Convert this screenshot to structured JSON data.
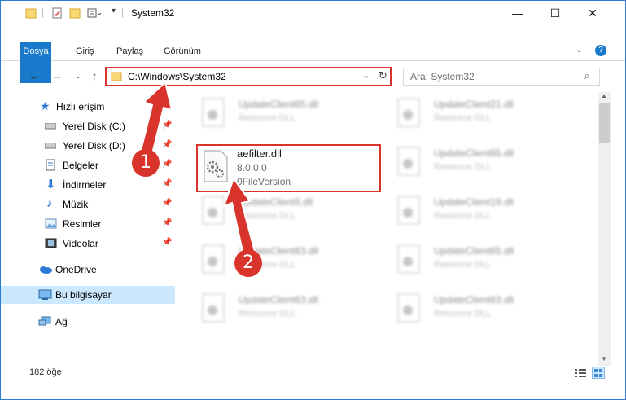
{
  "window": {
    "title": "System32"
  },
  "ribbon": {
    "tabs": [
      "Dosya",
      "Giriş",
      "Paylaş",
      "Görünüm"
    ]
  },
  "address": {
    "path": "C:\\Windows\\System32"
  },
  "search": {
    "placeholder": "Ara: System32"
  },
  "sidebar": {
    "items": [
      {
        "label": "Hızlı erişim"
      },
      {
        "label": "Yerel Disk (C:)"
      },
      {
        "label": "Yerel Disk (D:)"
      },
      {
        "label": "Belgeler"
      },
      {
        "label": "İndirmeler"
      },
      {
        "label": "Müzik"
      },
      {
        "label": "Resimler"
      },
      {
        "label": "Videolar"
      },
      {
        "label": "OneDrive"
      },
      {
        "label": "Bu bilgisayar"
      },
      {
        "label": "Ağ"
      }
    ]
  },
  "highlight_file": {
    "name": "aefilter.dll",
    "version": "8.0.0.0",
    "file_version": "0FileVersion"
  },
  "files": [
    {
      "name": "UpdateClient65.dll",
      "desc": "Resource DLL"
    },
    {
      "name": "UpdateClient21.dll",
      "desc": "Resource DLL"
    },
    {
      "name": "UpdateClient65.dll",
      "desc": "Resource DLL"
    },
    {
      "name": "UpdateClient5.dll",
      "desc": "Resource DLL"
    },
    {
      "name": "UpdateClient19.dll",
      "desc": "Resource DLL"
    },
    {
      "name": "UpdateClient63.dll",
      "desc": "Resource DLL"
    },
    {
      "name": "UpdateClient65.dll",
      "desc": "Resource DLL"
    },
    {
      "name": "UpdateClient63.dll",
      "desc": "Resource DLL"
    },
    {
      "name": "UpdateClient63.dll",
      "desc": "Resource DLL"
    }
  ],
  "status": {
    "count": "182 öğe"
  },
  "badges": [
    "1",
    "2"
  ],
  "colors": {
    "accent": "#1979ca",
    "highlight": "#d9342b",
    "selection": "#cce8ff"
  }
}
